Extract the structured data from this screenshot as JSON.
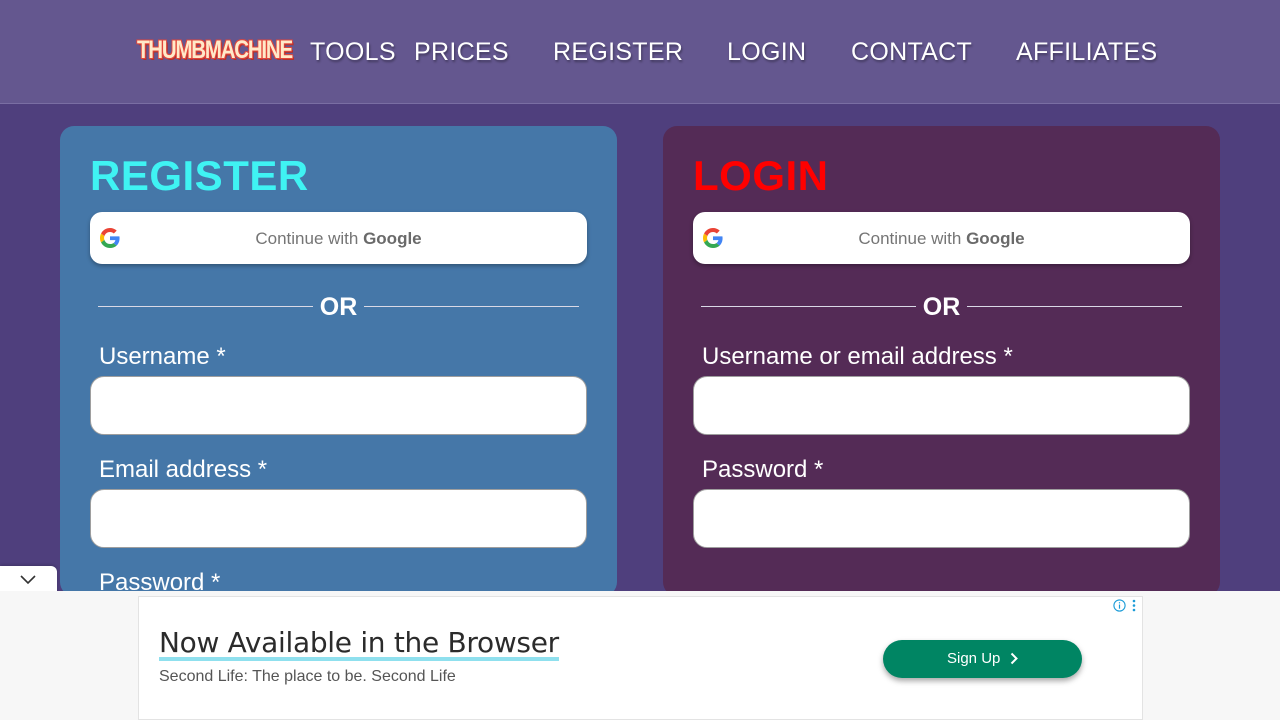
{
  "nav": {
    "logo": "THUMBMACHINE",
    "links": [
      "TOOLS",
      "PRICES",
      "REGISTER",
      "LOGIN",
      "CONTACT",
      "AFFILIATES"
    ]
  },
  "register": {
    "title": "REGISTER",
    "google": {
      "prefix": "Continue with ",
      "brand": "Google"
    },
    "or": "OR",
    "fields": [
      {
        "label": "Username *",
        "value": ""
      },
      {
        "label": "Email address *",
        "value": ""
      },
      {
        "label": "Password *",
        "value": ""
      }
    ],
    "title_color": "#3ff3f3",
    "bg_color": "#4577a8"
  },
  "login": {
    "title": "LOGIN",
    "google": {
      "prefix": "Continue with ",
      "brand": "Google"
    },
    "or": "OR",
    "fields": [
      {
        "label": "Username or email address *",
        "value": ""
      },
      {
        "label": "Password *",
        "value": ""
      }
    ],
    "title_color": "#ff0000",
    "bg_color": "#542b56"
  },
  "ad": {
    "title": "Now Available in the Browser",
    "subtitle": "Second Life: The place to be. Second Life",
    "button": "Sign Up",
    "button_color": "#008563",
    "icons": [
      "info-icon",
      "more-vertical-icon",
      "chevron-right-icon"
    ]
  },
  "collapse": {
    "icon": "chevron-down-icon"
  },
  "page": {
    "background": "#4f3f7d",
    "nav_background": "#64578f"
  }
}
